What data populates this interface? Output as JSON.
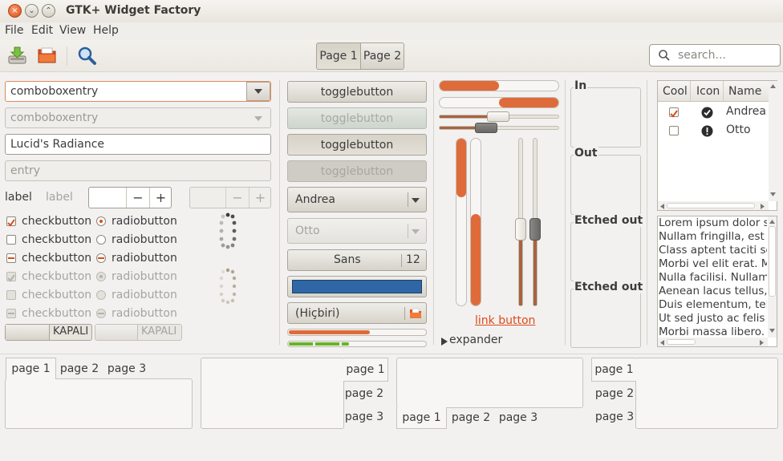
{
  "window": {
    "title": "GTK+ Widget Factory",
    "close_glyph": "×",
    "min_glyph": "⌄",
    "max_glyph": "⌃"
  },
  "menu": {
    "items": [
      "File",
      "Edit",
      "View",
      "Help"
    ]
  },
  "toolbar": {
    "page1_label": "Page 1",
    "page2_label": "Page 2",
    "search_placeholder": "search..."
  },
  "left": {
    "combo1_value": "comboboxentry",
    "combo2_value": "comboboxentry",
    "entry1_value": "Lucid's Radiance",
    "entry2_placeholder": "entry",
    "label1": "label",
    "label2": "label",
    "spin_minus": "−",
    "spin_plus": "+",
    "check_labels": [
      "checkbutton",
      "checkbutton",
      "checkbutton",
      "checkbutton",
      "checkbutton",
      "checkbutton"
    ],
    "radio_labels": [
      "radiobutton",
      "radiobutton",
      "radiobutton",
      "radiobutton",
      "radiobutton",
      "radiobutton"
    ],
    "switch1_label": "KAPALI",
    "switch2_label": "KAPALI"
  },
  "middle": {
    "toggle_labels": [
      "togglebutton",
      "togglebutton",
      "togglebutton",
      "togglebutton"
    ],
    "combo_andrea": "Andrea",
    "combo_otto": "Otto",
    "font_name": "Sans",
    "font_size": "12",
    "file_chooser": "(Hiçbiri)",
    "color_swatch": "#2f66a6",
    "progress_orange": 0.6,
    "progress_green": 0.45
  },
  "sliders": {
    "hprogress1": 0.5,
    "hprogress2": 0.5,
    "hscale1": 0.5,
    "hscale2": 0.4,
    "vprogress1": 0.35,
    "vprogress2": 0.55,
    "vscale1": 0.45,
    "vscale2": 0.45,
    "link_button": "link button",
    "expander": "expander",
    "accent": "#df6b3a"
  },
  "frames": {
    "labels": [
      "In",
      "Out",
      "Etched out",
      "Etched out"
    ]
  },
  "tree": {
    "columns": [
      "Cool",
      "Icon",
      "Name"
    ],
    "rows": [
      {
        "checked": true,
        "icon": "check-circle-icon",
        "name": "Andrea"
      },
      {
        "checked": false,
        "icon": "warning-circle-icon",
        "name": "Otto"
      }
    ]
  },
  "textview": {
    "lines": [
      "Lorem ipsum dolor s",
      "Nullam fringilla, est",
      "Class aptent taciti sc",
      "Morbi vel elit erat. M",
      "Nulla facilisi. Nullam",
      "Aenean lacus tellus,",
      "Duis elementum, tel",
      "Ut sed justo ac felis",
      "Morbi massa libero."
    ]
  },
  "notebooks": {
    "nb1": [
      "page 1",
      "page 2",
      "page 3"
    ],
    "nb2": [
      "page 1",
      "page 2",
      "page 3"
    ],
    "nb3": [
      "page 1",
      "page 2",
      "page 3"
    ],
    "nb4": [
      "page 1",
      "page 2",
      "page 3"
    ]
  }
}
